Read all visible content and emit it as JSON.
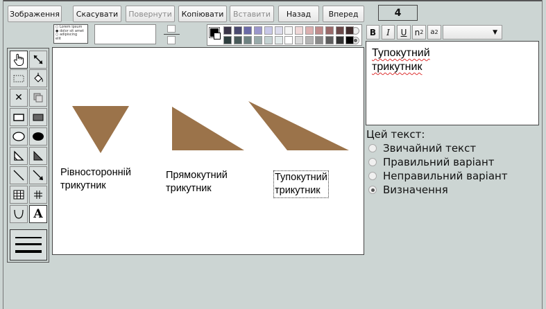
{
  "toolbar": {
    "image_label": "Зображення",
    "cancel_label": "Скасувати",
    "return_label": "Повернути",
    "copy_label": "Копіювати",
    "paste_label": "Вставити",
    "back_label": "Назад",
    "forward_label": "Вперед",
    "counter": "4"
  },
  "text_style_preview": [
    "Lorem ipsum",
    "dolor sit amet",
    "adipiscing",
    "elit"
  ],
  "palette": {
    "current_color": "#000000",
    "row1": [
      "#3a3548",
      "#4a4a70",
      "#6a6aa8",
      "#9a96cc",
      "#c8c8e8",
      "#dcdcec",
      "#f4f4f4",
      "#f0d8d8",
      "#dcb0b0",
      "#c08c8c",
      "#9a6a6a",
      "#6a4848",
      "#402c2c"
    ],
    "row2": [
      "#2e3e3e",
      "#485a5a",
      "#6e8282",
      "#98aaaa",
      "#c4d2d2",
      "#e2eaea",
      "#ffffff",
      "#dadada",
      "#b4b4b4",
      "#8a8a8a",
      "#5e5e5e",
      "#333333",
      "#000000"
    ]
  },
  "format": {
    "bold": "B",
    "italic": "I",
    "underline": "U",
    "superscript_base": "n",
    "superscript_exp": "2",
    "subscript_base": "a",
    "subscript_idx": "2",
    "font_select_arrow": "▼"
  },
  "tool_icons": [
    "hand-pointer-icon",
    "resize-arrow-icon",
    "dotted-rect-select-icon",
    "fill-bucket-icon",
    "delete-x-icon",
    "copy-icon",
    "rect-outline-icon",
    "rect-filled-icon",
    "ellipse-outline-icon",
    "ellipse-filled-icon",
    "triangle-outline-icon",
    "triangle-filled-icon",
    "line-icon",
    "arrow-icon",
    "table-icon",
    "grid-icon",
    "curve-icon",
    "text-icon"
  ],
  "text_tool_glyph": "A",
  "canvas": {
    "shape_color": "#9b734a",
    "labels": [
      "Рівносторонній\nтрикутник",
      "Прямокутний\nтрикутник",
      "Тупокутний\nтрикутник"
    ]
  },
  "editor": {
    "text": "Тупокутний\nтрикутник"
  },
  "kind": {
    "title": "Цей текст:",
    "options": [
      "Звичайний текст",
      "Правильний варіант",
      "Неправильний варіант",
      "Визначення"
    ],
    "selected_index": 3
  }
}
